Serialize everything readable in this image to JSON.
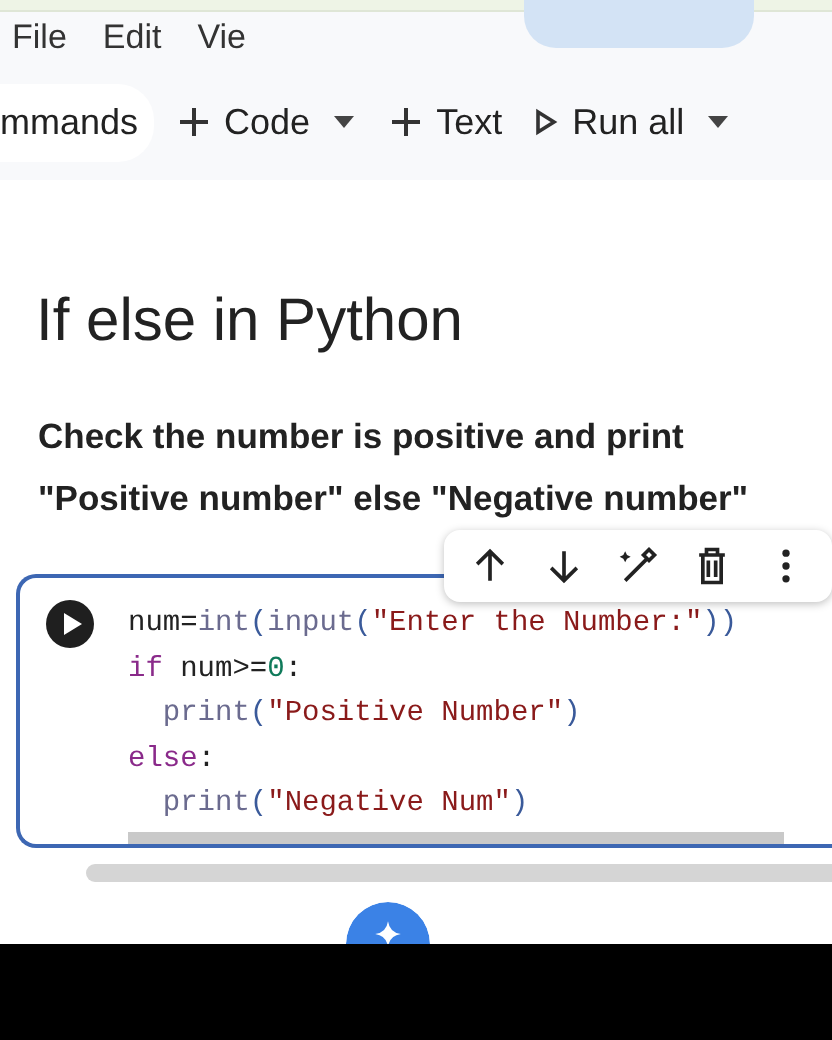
{
  "menu": [
    "File",
    "Edit",
    "Vie"
  ],
  "toolbar": [
    {
      "kind": "pill",
      "label": "mmands"
    },
    {
      "kind": "add",
      "label": "Code"
    },
    {
      "kind": "caret"
    },
    {
      "kind": "add",
      "label": "Text"
    },
    {
      "kind": "run",
      "label": "Run all"
    },
    {
      "kind": "caret"
    }
  ],
  "heading": "If else in Python",
  "description": "Check the number is positive and print \"Positive number\" else \"Negative number\"",
  "cell_toolbar": [
    {
      "kind": "up"
    },
    {
      "kind": "down"
    },
    {
      "kind": "edit"
    },
    {
      "kind": "delete"
    },
    {
      "kind": "more"
    }
  ],
  "code_lines": [
    {
      "tokens": [
        {
          "text": "num=",
          "kind": "plain"
        },
        {
          "text": "int",
          "kind": "builtin"
        },
        {
          "text": "(",
          "kind": "paren"
        },
        {
          "text": "input",
          "kind": "builtin"
        },
        {
          "text": "(",
          "kind": "paren"
        },
        {
          "text": "\"Enter the Number:\"",
          "kind": "string"
        },
        {
          "text": "))",
          "kind": "paren"
        }
      ]
    },
    {
      "tokens": [
        {
          "text": "if",
          "kind": "keyword"
        },
        {
          "text": " num>=",
          "kind": "plain"
        },
        {
          "text": "0",
          "kind": "number"
        },
        {
          "text": ":",
          "kind": "plain"
        }
      ]
    },
    {
      "tokens": [
        {
          "text": "  print",
          "kind": "builtin"
        },
        {
          "text": "(",
          "kind": "paren"
        },
        {
          "text": "\"Positive Number\"",
          "kind": "string"
        },
        {
          "text": ")",
          "kind": "paren"
        }
      ]
    },
    {
      "tokens": [
        {
          "text": "else",
          "kind": "keyword"
        },
        {
          "text": ":",
          "kind": "plain"
        }
      ]
    },
    {
      "tokens": [
        {
          "text": "  print",
          "kind": "builtin"
        },
        {
          "text": "(",
          "kind": "paren"
        },
        {
          "text": "\"Negative Num",
          "kind": "string"
        },
        {
          "text": "\"",
          "kind": "string"
        },
        {
          "text": ")",
          "kind": "paren"
        }
      ]
    }
  ]
}
